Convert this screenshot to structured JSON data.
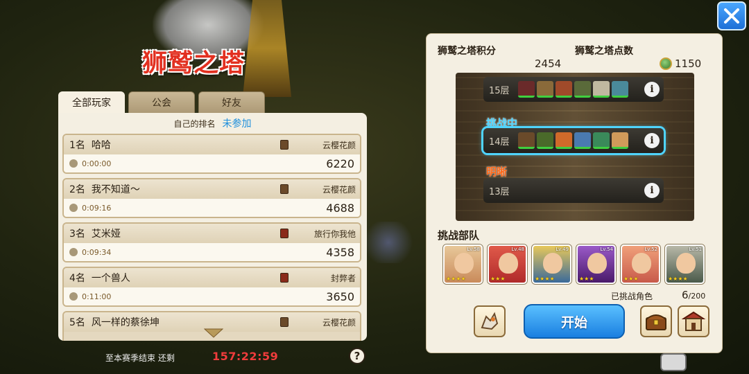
{
  "logo": {
    "title": "狮鹫之塔"
  },
  "tabs": [
    {
      "label": "全部玩家",
      "active": true
    },
    {
      "label": "公会",
      "active": false
    },
    {
      "label": "好友",
      "active": false
    }
  ],
  "self_rank": {
    "label": "自己的排名",
    "value": "未参加"
  },
  "rankings": [
    {
      "rank": "1名",
      "name": "哈哈",
      "guild": "云樱花颜",
      "time": "0:00:00",
      "score": "6220"
    },
    {
      "rank": "2名",
      "name": "我不知道～",
      "guild": "云樱花颜",
      "time": "0:09:16",
      "score": "4688"
    },
    {
      "rank": "3名",
      "name": "艾米娅",
      "guild": "旅行你我他",
      "time": "0:09:34",
      "score": "4358"
    },
    {
      "rank": "4名",
      "name": "一个兽人",
      "guild": "封弊者",
      "time": "0:11:00",
      "score": "3650"
    },
    {
      "rank": "5名",
      "name": "风一样的蔡徐坤",
      "guild": "云樱花颜",
      "time": "",
      "score": ""
    }
  ],
  "season": {
    "label": "至本赛季结束 还剩",
    "timer": "157:22:59"
  },
  "help": {
    "label": "?"
  },
  "tower_info": {
    "score_label": "狮鹫之塔积分",
    "score": "2454",
    "points_label": "狮鹫之塔点数",
    "points": "1150"
  },
  "floors": [
    {
      "name": "15层",
      "status": "",
      "enemies": [
        "#6a2a2a",
        "#8a6a3a",
        "#a04a2a",
        "#5a6a3a",
        "#c0b8a0",
        "#4a8a9a"
      ]
    },
    {
      "name": "14层",
      "status": "挑战中",
      "enemies": [
        "#6a4a2a",
        "#4a6a2a",
        "#d06a2a",
        "#4a7ab0",
        "#3a8a5a",
        "#d09a5a"
      ]
    },
    {
      "name": "13层",
      "status": "明晰",
      "enemies": []
    }
  ],
  "colors": {
    "challenging": "#4fd4ff",
    "clear": "#ff6a1a",
    "start": "#2b8cf0",
    "timer": "#f03c3c"
  },
  "squad": {
    "title": "挑战部队",
    "heroes": [
      {
        "stars": "★★★★",
        "level": "Lv.58",
        "color": "#c98a5a"
      },
      {
        "stars": "★★★",
        "level": "Lv.48",
        "color": "#b02a2a"
      },
      {
        "stars": "★★★★",
        "level": "Lv.49",
        "color": "#3a6a9a"
      },
      {
        "stars": "★★★",
        "level": "Lv.54",
        "color": "#6a2a8a"
      },
      {
        "stars": "★★★",
        "level": "Lv.52",
        "color": "#c85a4a"
      },
      {
        "stars": "★★★★",
        "level": "Lv.51",
        "color": "#4a5a4a"
      }
    ],
    "used_label": "已挑战角色",
    "used_count": "6",
    "used_max": "/200"
  },
  "buttons": {
    "start": "开始"
  },
  "icons": {
    "close": "close-icon",
    "griffin": "griffin-icon",
    "chest": "treasure-chest-icon",
    "shop": "shop-icon",
    "chat": "chat-icon"
  }
}
